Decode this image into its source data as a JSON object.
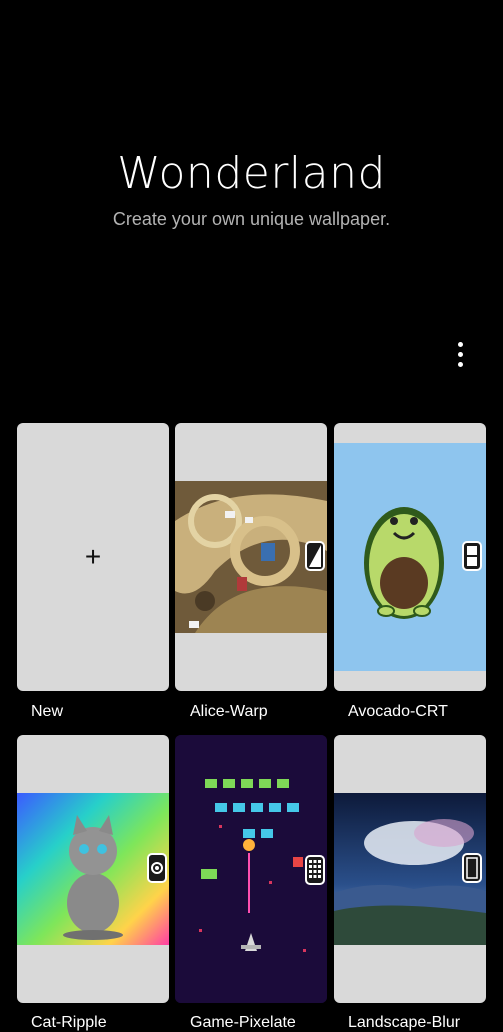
{
  "header": {
    "title": "Wonderland",
    "subtitle": "Create your own unique wallpaper."
  },
  "toolbar": {
    "more_icon": "more-vertical-icon"
  },
  "tiles": [
    {
      "label": "New",
      "icon": "plus-icon",
      "plus": "+"
    },
    {
      "label": "Alice-Warp",
      "badge_icon": "diagonal-fill-icon"
    },
    {
      "label": "Avocado-CRT",
      "badge_icon": "crt-screen-icon"
    },
    {
      "label": "Cat-Ripple",
      "badge_icon": "ripple-circle-icon"
    },
    {
      "label": "Game-Pixelate",
      "badge_icon": "pixel-grid-icon"
    },
    {
      "label": "Landscape-Blur",
      "badge_icon": "blur-icon"
    }
  ],
  "colors": {
    "background": "#000000",
    "tile_bg": "#d9d9d9",
    "avocado_bg": "#8ec5ee",
    "game_bg": "#1b0b3a"
  }
}
